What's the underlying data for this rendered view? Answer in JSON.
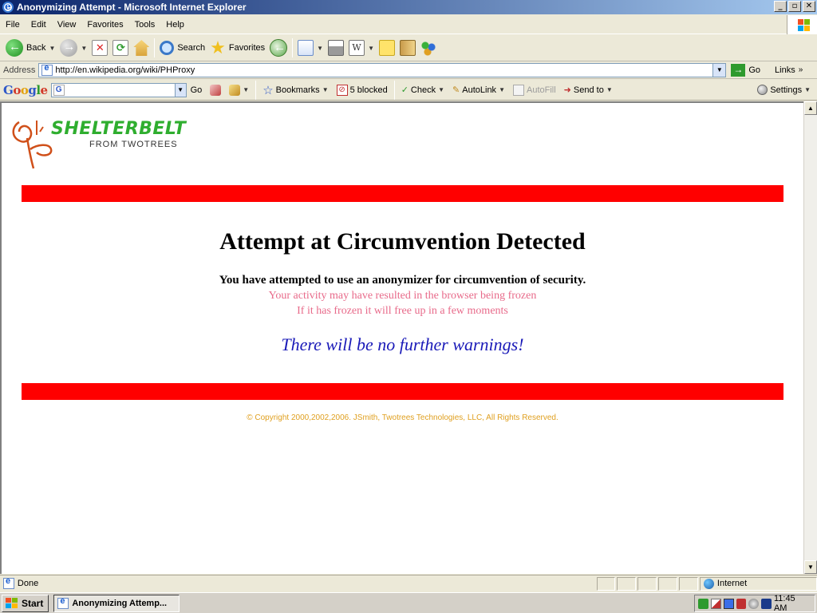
{
  "window": {
    "title": "Anonymizing Attempt - Microsoft Internet Explorer",
    "controls": {
      "minimize": "_",
      "maximize": "▫",
      "close": "✕"
    }
  },
  "menu": {
    "items": [
      "File",
      "Edit",
      "View",
      "Favorites",
      "Tools",
      "Help"
    ]
  },
  "toolbar": {
    "back_label": "Back",
    "search_label": "Search",
    "favorites_label": "Favorites"
  },
  "address": {
    "label": "Address",
    "url": "http://en.wikipedia.org/wiki/PHProxy",
    "go_label": "Go",
    "links_label": "Links"
  },
  "google_toolbar": {
    "logo_letters": [
      "G",
      "o",
      "o",
      "g",
      "l",
      "e"
    ],
    "search_value": "",
    "go_label": "Go",
    "bookmarks_label": "Bookmarks",
    "blocked_label": "5 blocked",
    "check_label": "Check",
    "autolink_label": "AutoLink",
    "autofill_label": "AutoFill",
    "sendto_label": "Send to",
    "settings_label": "Settings"
  },
  "page": {
    "logo_name": "SHELTERBELT",
    "logo_sub": "FROM TWOTREES",
    "heading": "Attempt at Circumvention Detected",
    "line1": "You have attempted to use an anonymizer for circumvention of security.",
    "line2": "Your activity may have resulted in the browser being frozen",
    "line3": "If it has frozen it will free up in a few moments",
    "warning": "There will be no further warnings!",
    "copyright": "© Copyright 2000,2002,2006. JSmith, Twotrees Technologies, LLC, All Rights Reserved.",
    "colors": {
      "bar": "#ff0000",
      "pink_text": "#e86a8a",
      "warning_text": "#1a1ab8",
      "copyright_text": "#e0a020",
      "logo_green": "#2fae2f",
      "logo_orange": "#d0501a"
    }
  },
  "status": {
    "text": "Done",
    "zone": "Internet"
  },
  "taskbar": {
    "start_label": "Start",
    "task_label": "Anonymizing Attemp...",
    "clock": "11:45 AM"
  }
}
